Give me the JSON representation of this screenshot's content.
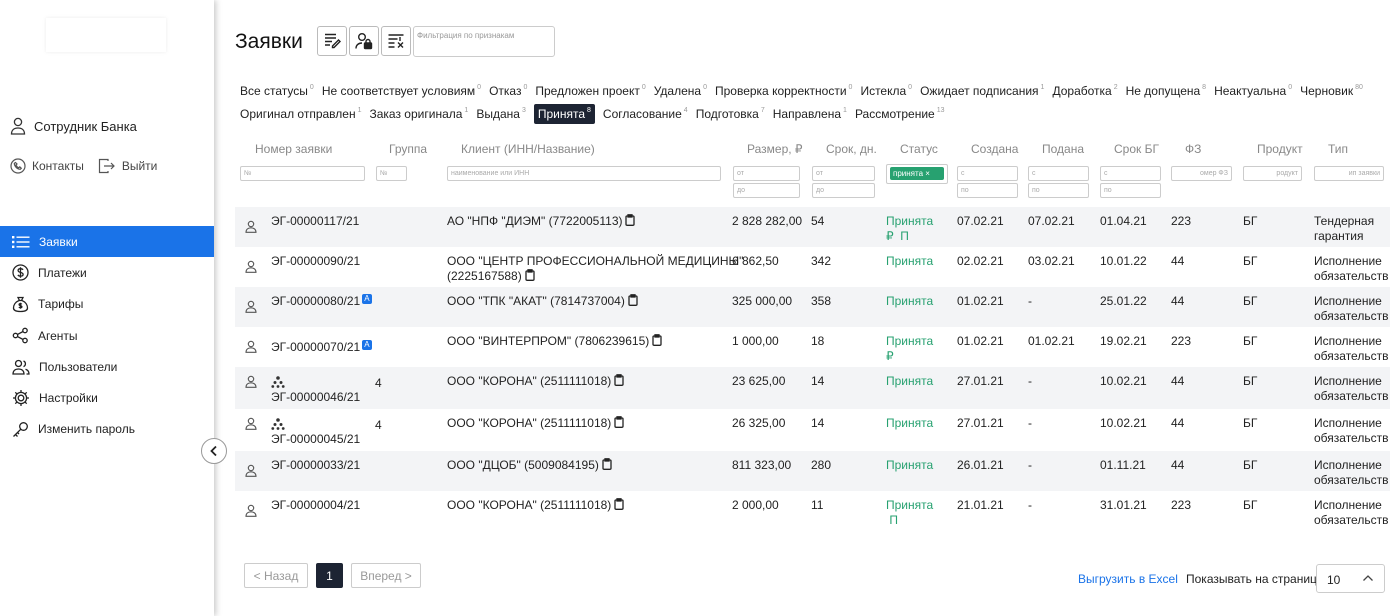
{
  "sidebar": {
    "user": "Сотрудник Банка",
    "contacts": "Контакты",
    "logout": "Выйти",
    "nav": [
      {
        "label": "Заявки",
        "icon": "list-icon"
      },
      {
        "label": "Платежи",
        "icon": "dollar-icon"
      },
      {
        "label": "Тарифы",
        "icon": "money-bag-icon"
      },
      {
        "label": "Агенты",
        "icon": "share-icon"
      },
      {
        "label": "Пользователи",
        "icon": "users-icon"
      },
      {
        "label": "Настройки",
        "icon": "gear-icon"
      },
      {
        "label": "Изменить пароль",
        "icon": "key-icon"
      }
    ]
  },
  "page": {
    "title": "Заявки",
    "filter_placeholder": "Фильтрация по признакам"
  },
  "status_filters_row1": [
    {
      "label": "Все статусы",
      "count": "0"
    },
    {
      "label": "Не соответствует условиям",
      "count": "0"
    },
    {
      "label": "Отказ",
      "count": "0"
    },
    {
      "label": "Предложен проект",
      "count": "0"
    },
    {
      "label": "Удалена",
      "count": "0"
    },
    {
      "label": "Проверка корректности",
      "count": "0"
    },
    {
      "label": "Истекла",
      "count": "0"
    },
    {
      "label": "Ожидает подписания",
      "count": "1"
    },
    {
      "label": "Доработка",
      "count": "2"
    },
    {
      "label": "Не допущена",
      "count": "8"
    },
    {
      "label": "Неактуальна",
      "count": "0"
    },
    {
      "label": "Черновик",
      "count": "80"
    }
  ],
  "status_filters_row2": [
    {
      "label": "Оригинал отправлен",
      "count": "1"
    },
    {
      "label": "Заказ оригинала",
      "count": "1"
    },
    {
      "label": "Выдана",
      "count": "3"
    },
    {
      "label": "Принята",
      "count": "8",
      "selected": true
    },
    {
      "label": "Согласование",
      "count": "4"
    },
    {
      "label": "Подготовка",
      "count": "7"
    },
    {
      "label": "Направлена",
      "count": "1"
    },
    {
      "label": "Рассмотрение",
      "count": "13"
    }
  ],
  "columns": {
    "number": "Номер заявки",
    "group": "Группа",
    "client": "Клиент (ИНН/Название)",
    "amount": "Размер, ₽",
    "term": "Срок, дн.",
    "status": "Статус",
    "created": "Создана",
    "submitted": "Подана",
    "bg_term": "Срок БГ",
    "law": "ФЗ",
    "product": "Продукт",
    "type": "Тип"
  },
  "filters": {
    "number_ph": "№",
    "group_ph": "№",
    "client_ph": "наименование или ИНН",
    "from_ph": "от",
    "to_ph": "до",
    "s_ph": "с",
    "po_ph": "по",
    "status_value": "принята",
    "law_ph": "омер ФЗ",
    "product_ph": "родукт",
    "type_ph": "ип заявки"
  },
  "rows": [
    {
      "number": "ЭГ-00000117/21",
      "badge": "",
      "group": "",
      "client": [
        "АО \"НПФ \"ДИЭМ\" (7722005113)"
      ],
      "amount": "2 828 282,00",
      "term": "54",
      "status": [
        "Принята",
        "₽  П"
      ],
      "created": "07.02.21",
      "submitted": "07.02.21",
      "bg_term": "01.04.21",
      "law": "223",
      "product": "БГ",
      "type": [
        "Тендерная",
        "гарантия"
      ]
    },
    {
      "number": "ЭГ-00000090/21",
      "badge": "",
      "group": "",
      "client": [
        "ООО \"ЦЕНТР ПРОФЕССИОНАЛЬНОЙ МЕДИЦИНЫ\"",
        "(2225167588)"
      ],
      "amount": "6 862,50",
      "term": "342",
      "status": [
        "Принята"
      ],
      "created": "02.02.21",
      "submitted": "03.02.21",
      "bg_term": "10.01.22",
      "law": "44",
      "product": "БГ",
      "type": [
        "Исполнение",
        "обязательств"
      ]
    },
    {
      "number": "ЭГ-00000080/21",
      "badge": "A",
      "group": "",
      "client": [
        "ООО \"ТПК \"АКАТ\" (7814737004)"
      ],
      "amount": "325 000,00",
      "term": "358",
      "status": [
        "Принята"
      ],
      "created": "01.02.21",
      "submitted": "-",
      "bg_term": "25.01.22",
      "law": "44",
      "product": "БГ",
      "type": [
        "Исполнение",
        "обязательств"
      ]
    },
    {
      "number": "ЭГ-00000070/21",
      "badge": "A",
      "group": "",
      "client": [
        "ООО \"ВИНТЕРПРОМ\" (7806239615)"
      ],
      "amount": "1 000,00",
      "term": "18",
      "status": [
        "Принята",
        "₽"
      ],
      "created": "01.02.21",
      "submitted": "01.02.21",
      "bg_term": "19.02.21",
      "law": "223",
      "product": "БГ",
      "type": [
        "Исполнение",
        "обязательств"
      ]
    },
    {
      "number": "ЭГ-00000046/21",
      "badge": "",
      "group": "4",
      "client": [
        "ООО \"КОРОНА\" (2511111018)"
      ],
      "amount": "23 625,00",
      "term": "14",
      "status": [
        "Принята"
      ],
      "created": "27.01.21",
      "submitted": "-",
      "bg_term": "10.02.21",
      "law": "44",
      "product": "БГ",
      "type": [
        "Исполнение",
        "обязательств"
      ]
    },
    {
      "number": "ЭГ-00000045/21",
      "badge": "",
      "group": "4",
      "client": [
        "ООО \"КОРОНА\" (2511111018)"
      ],
      "amount": "26 325,00",
      "term": "14",
      "status": [
        "Принята"
      ],
      "created": "27.01.21",
      "submitted": "-",
      "bg_term": "10.02.21",
      "law": "44",
      "product": "БГ",
      "type": [
        "Исполнение",
        "обязательств"
      ]
    },
    {
      "number": "ЭГ-00000033/21",
      "badge": "",
      "group": "",
      "client": [
        "ООО \"ДЦОБ\" (5009084195)"
      ],
      "amount": "811 323,00",
      "term": "280",
      "status": [
        "Принята"
      ],
      "created": "26.01.21",
      "submitted": "-",
      "bg_term": "01.11.21",
      "law": "44",
      "product": "БГ",
      "type": [
        "Исполнение",
        "обязательств"
      ]
    },
    {
      "number": "ЭГ-00000004/21",
      "badge": "",
      "group": "",
      "client": [
        "ООО \"КОРОНА\" (2511111018)"
      ],
      "amount": "2 000,00",
      "term": "11",
      "status": [
        "Принята",
        " П"
      ],
      "created": "21.01.21",
      "submitted": "-",
      "bg_term": "31.01.21",
      "law": "223",
      "product": "БГ",
      "type": [
        "Исполнение",
        "обязательств"
      ]
    }
  ],
  "pagination": {
    "prev": "< Назад",
    "current": "1",
    "next": "Вперед >"
  },
  "footer": {
    "export": "Выгрузить в Excel",
    "per_page_label": "Показывать на странице:",
    "per_page_value": "10"
  },
  "colors": {
    "accent": "#1a73e8",
    "dark": "#1d2433",
    "green": "#27a170"
  }
}
